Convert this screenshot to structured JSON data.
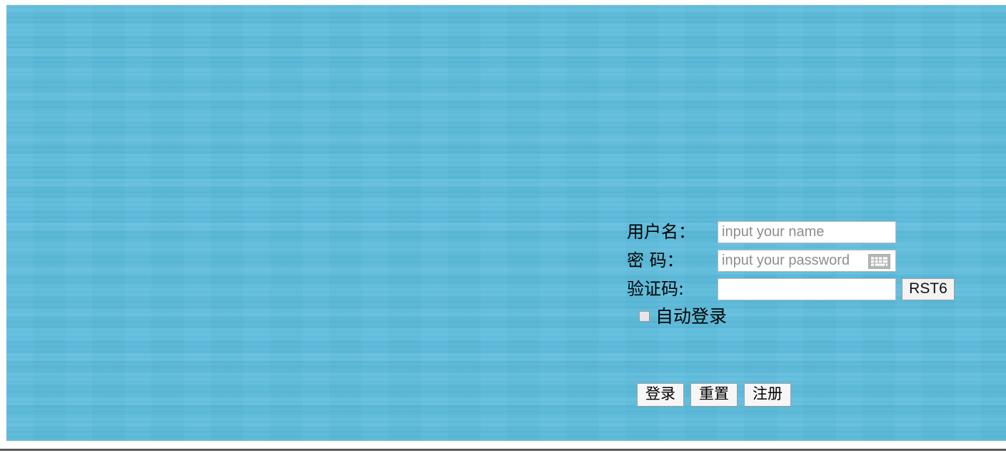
{
  "page": {
    "background_color": "#5bbcdc",
    "frame_color": "#ffffff"
  },
  "login_form": {
    "username": {
      "label": "用户名：",
      "placeholder": "input your name",
      "value": ""
    },
    "password": {
      "label": "密 码：",
      "placeholder": "input your password",
      "value": "",
      "keyboard_icon": "keyboard-icon"
    },
    "captcha": {
      "label": "验证码:",
      "placeholder": "",
      "value": "",
      "code": "RST6"
    },
    "auto_login": {
      "label": "自动登录",
      "checked": false
    },
    "buttons": {
      "login": "登录",
      "reset": "重置",
      "register": "注册"
    }
  }
}
